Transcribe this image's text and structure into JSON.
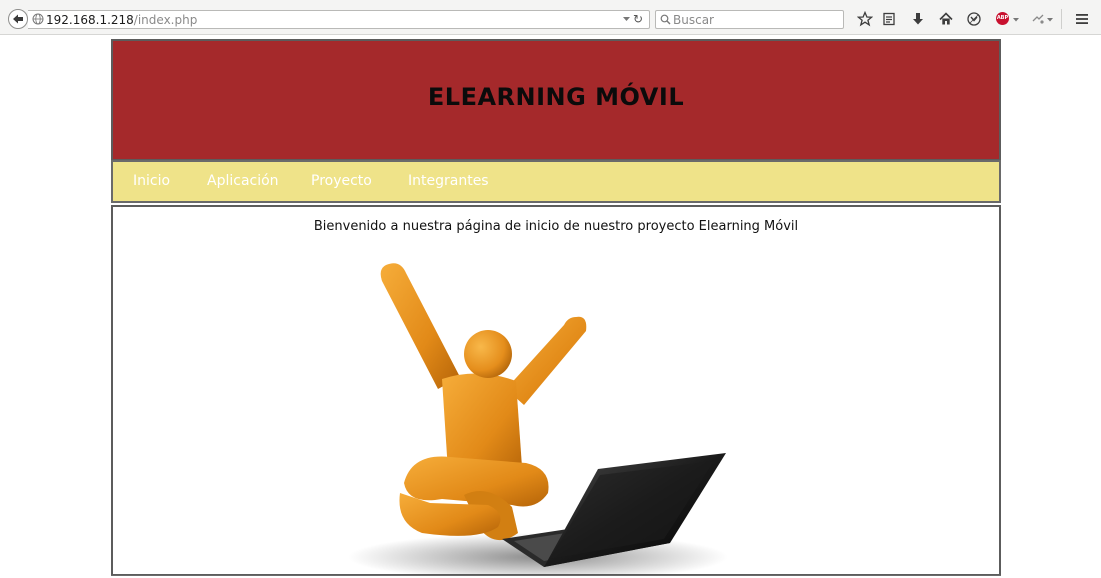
{
  "browser": {
    "url_host": "192.168.1.218",
    "url_path": "/index.php",
    "search_placeholder": "Buscar",
    "abp_label": "ABP",
    "toolbar_icons": [
      "star-icon",
      "reading-list-icon",
      "download-icon",
      "home-icon",
      "pocket-icon",
      "adblock-icon",
      "extension-icon",
      "menu-icon"
    ]
  },
  "site": {
    "title": "ELEARNING MÓVIL",
    "nav": [
      "Inicio",
      "Aplicación",
      "Proyecto",
      "Integrantes"
    ],
    "welcome": "Bienvenido a nuestra página de inicio de nuestro proyecto Elearning Móvil",
    "hero_image": "celebrating-figure-with-laptop-illustration"
  },
  "colors": {
    "header_bg": "#a5292b",
    "nav_bg": "#efe389",
    "nav_text": "#ffffff",
    "figure": "#e8961e"
  }
}
